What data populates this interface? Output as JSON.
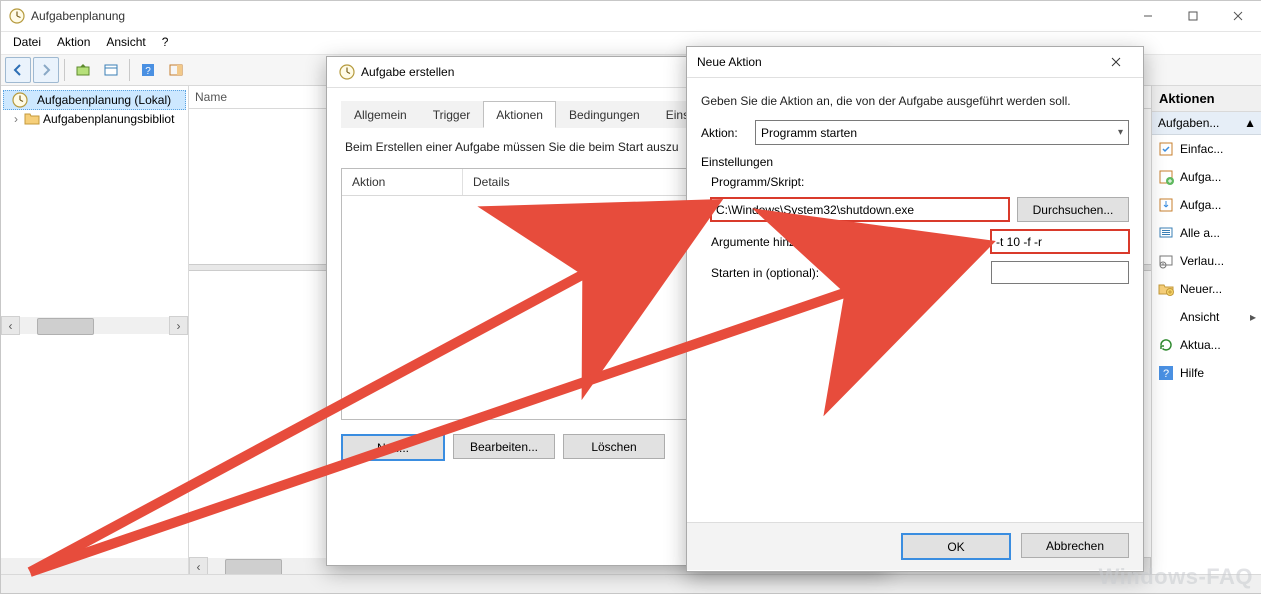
{
  "main": {
    "title": "Aufgabenplanung",
    "menu": [
      "Datei",
      "Aktion",
      "Ansicht",
      "?"
    ],
    "tree": {
      "root": "Aufgabenplanung (Lokal)",
      "child": "Aufgabenplanungsbibliot"
    },
    "name_header": "Name"
  },
  "actions_pane": {
    "header": "Aktionen",
    "group": "Aufgaben...",
    "items": [
      {
        "label": "Einfac...",
        "icon": "task-basic"
      },
      {
        "label": "Aufga...",
        "icon": "task-create"
      },
      {
        "label": "Aufga...",
        "icon": "task-import"
      },
      {
        "label": "Alle a...",
        "icon": "display-all"
      },
      {
        "label": "Verlau...",
        "icon": "history"
      },
      {
        "label": "Neuer...",
        "icon": "folder-new"
      },
      {
        "label": "Ansicht",
        "icon": "view",
        "chevron": true
      },
      {
        "label": "Aktua...",
        "icon": "refresh"
      },
      {
        "label": "Hilfe",
        "icon": "help"
      }
    ]
  },
  "dlg_task": {
    "title": "Aufgabe erstellen",
    "tabs": [
      "Allgemein",
      "Trigger",
      "Aktionen",
      "Bedingungen",
      "Einstellungen"
    ],
    "active_tab": 2,
    "note": "Beim Erstellen einer Aufgabe müssen Sie die beim Start auszu",
    "cols": [
      "Aktion",
      "Details"
    ],
    "btn_new": "Neu...",
    "btn_edit": "Bearbeiten...",
    "btn_del": "Löschen"
  },
  "dlg_action": {
    "title": "Neue Aktion",
    "instruction": "Geben Sie die Aktion an, die von der Aufgabe ausgeführt werden soll.",
    "action_label": "Aktion:",
    "action_value": "Programm starten",
    "settings_label": "Einstellungen",
    "program_label": "Programm/Skript:",
    "program_value": "C:\\Windows\\System32\\shutdown.exe",
    "browse": "Durchsuchen...",
    "args_label": "Argumente hinzufügen (optional):",
    "args_value": "-t 10 -f -r",
    "startin_label": "Starten in (optional):",
    "startin_value": "",
    "ok": "OK",
    "cancel": "Abbrechen"
  },
  "watermark": "Windows-FAQ"
}
